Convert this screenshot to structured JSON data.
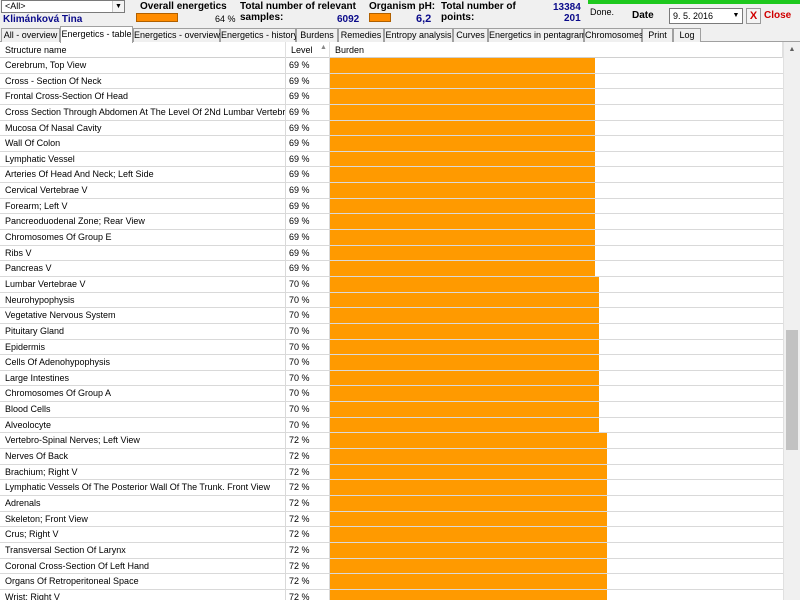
{
  "header": {
    "filter_value": "<All>",
    "patient_name": "Klimánková Tina",
    "overall_label": "Overall energetics",
    "overall_percent": 64,
    "overall_value": "64 %",
    "samples_label": "Total number of relevant samples:",
    "samples_value": "6092",
    "ph_label": "Organism pH:",
    "ph_value": "6,2",
    "points_label": "Total number of points:",
    "points_value1": "13384",
    "points_value2": "201",
    "status": "Done.",
    "date_label": "Date",
    "date_value": "9. 5. 2016",
    "close_x": "X",
    "close_label": "Close"
  },
  "tabs": [
    {
      "label": "All - overview",
      "active": false
    },
    {
      "label": "Energetics - table",
      "active": true
    },
    {
      "label": "Energetics - overview",
      "active": false
    },
    {
      "label": "Energetics - history",
      "active": false
    },
    {
      "label": "Burdens",
      "active": false
    },
    {
      "label": "Remedies",
      "active": false
    },
    {
      "label": "Entropy analysis",
      "active": false
    },
    {
      "label": "Curves",
      "active": false
    },
    {
      "label": "Energetics in pentagram",
      "active": false
    },
    {
      "label": "Chromosomes",
      "active": false
    },
    {
      "label": "Print",
      "active": false
    },
    {
      "label": "Log",
      "active": false
    }
  ],
  "columns": {
    "structure": "Structure name",
    "level": "Level",
    "burden": "Burden"
  },
  "rows": [
    {
      "name": "Cerebrum, Top View",
      "level": "69 %",
      "pct": 69
    },
    {
      "name": "Cross - Section Of Neck",
      "level": "69 %",
      "pct": 69
    },
    {
      "name": "Frontal Cross-Section Of Head",
      "level": "69 %",
      "pct": 69
    },
    {
      "name": "Cross Section Through Abdomen At The Level Of 2Nd Lumbar Vertebra",
      "level": "69 %",
      "pct": 69
    },
    {
      "name": "Mucosa Of Nasal Cavity",
      "level": "69 %",
      "pct": 69
    },
    {
      "name": "Wall Of Colon",
      "level": "69 %",
      "pct": 69
    },
    {
      "name": "Lymphatic Vessel",
      "level": "69 %",
      "pct": 69
    },
    {
      "name": "Arteries Of Head And Neck; Left Side",
      "level": "69 %",
      "pct": 69
    },
    {
      "name": "Cervical Vertebrae V",
      "level": "69 %",
      "pct": 69
    },
    {
      "name": "Forearm; Left V",
      "level": "69 %",
      "pct": 69
    },
    {
      "name": "Pancreoduodenal Zone; Rear View",
      "level": "69 %",
      "pct": 69
    },
    {
      "name": "Chromosomes Of Group E",
      "level": "69 %",
      "pct": 69
    },
    {
      "name": "Ribs V",
      "level": "69 %",
      "pct": 69
    },
    {
      "name": "Pancreas V",
      "level": "69 %",
      "pct": 69
    },
    {
      "name": "Lumbar Vertebrae V",
      "level": "70 %",
      "pct": 70
    },
    {
      "name": "Neurohypophysis",
      "level": "70 %",
      "pct": 70
    },
    {
      "name": "Vegetative Nervous System",
      "level": "70 %",
      "pct": 70
    },
    {
      "name": "Pituitary Gland",
      "level": "70 %",
      "pct": 70
    },
    {
      "name": "Epidermis",
      "level": "70 %",
      "pct": 70
    },
    {
      "name": "Cells Of Adenohypophysis",
      "level": "70 %",
      "pct": 70
    },
    {
      "name": "Large Intestines",
      "level": "70 %",
      "pct": 70
    },
    {
      "name": "Chromosomes Of Group A",
      "level": "70 %",
      "pct": 70
    },
    {
      "name": "Blood Cells",
      "level": "70 %",
      "pct": 70
    },
    {
      "name": "Alveolocyte",
      "level": "70 %",
      "pct": 70
    },
    {
      "name": "Vertebro-Spinal Nerves; Left View",
      "level": "72 %",
      "pct": 72
    },
    {
      "name": "Nerves Of Back",
      "level": "72 %",
      "pct": 72
    },
    {
      "name": "Brachium; Right V",
      "level": "72 %",
      "pct": 72
    },
    {
      "name": "Lymphatic Vessels Of The Posterior Wall Of The Trunk. Front View",
      "level": "72 %",
      "pct": 72
    },
    {
      "name": "Adrenals",
      "level": "72 %",
      "pct": 72
    },
    {
      "name": "Skeleton; Front View",
      "level": "72 %",
      "pct": 72
    },
    {
      "name": "Crus; Right V",
      "level": "72 %",
      "pct": 72
    },
    {
      "name": "Transversal Section Of Larynx",
      "level": "72 %",
      "pct": 72
    },
    {
      "name": "Coronal Cross-Section Of Left Hand",
      "level": "72 %",
      "pct": 72
    },
    {
      "name": "Organs Of Retroperitoneal Space",
      "level": "72 %",
      "pct": 72
    },
    {
      "name": "Wrist; Right V",
      "level": "72 %",
      "pct": 72
    }
  ],
  "colors": {
    "bar": "#ff9a00",
    "header_bar": "#ff8c00",
    "accent_text": "#0a0a8a",
    "close": "#d00000",
    "progress": "#1ec81e"
  }
}
